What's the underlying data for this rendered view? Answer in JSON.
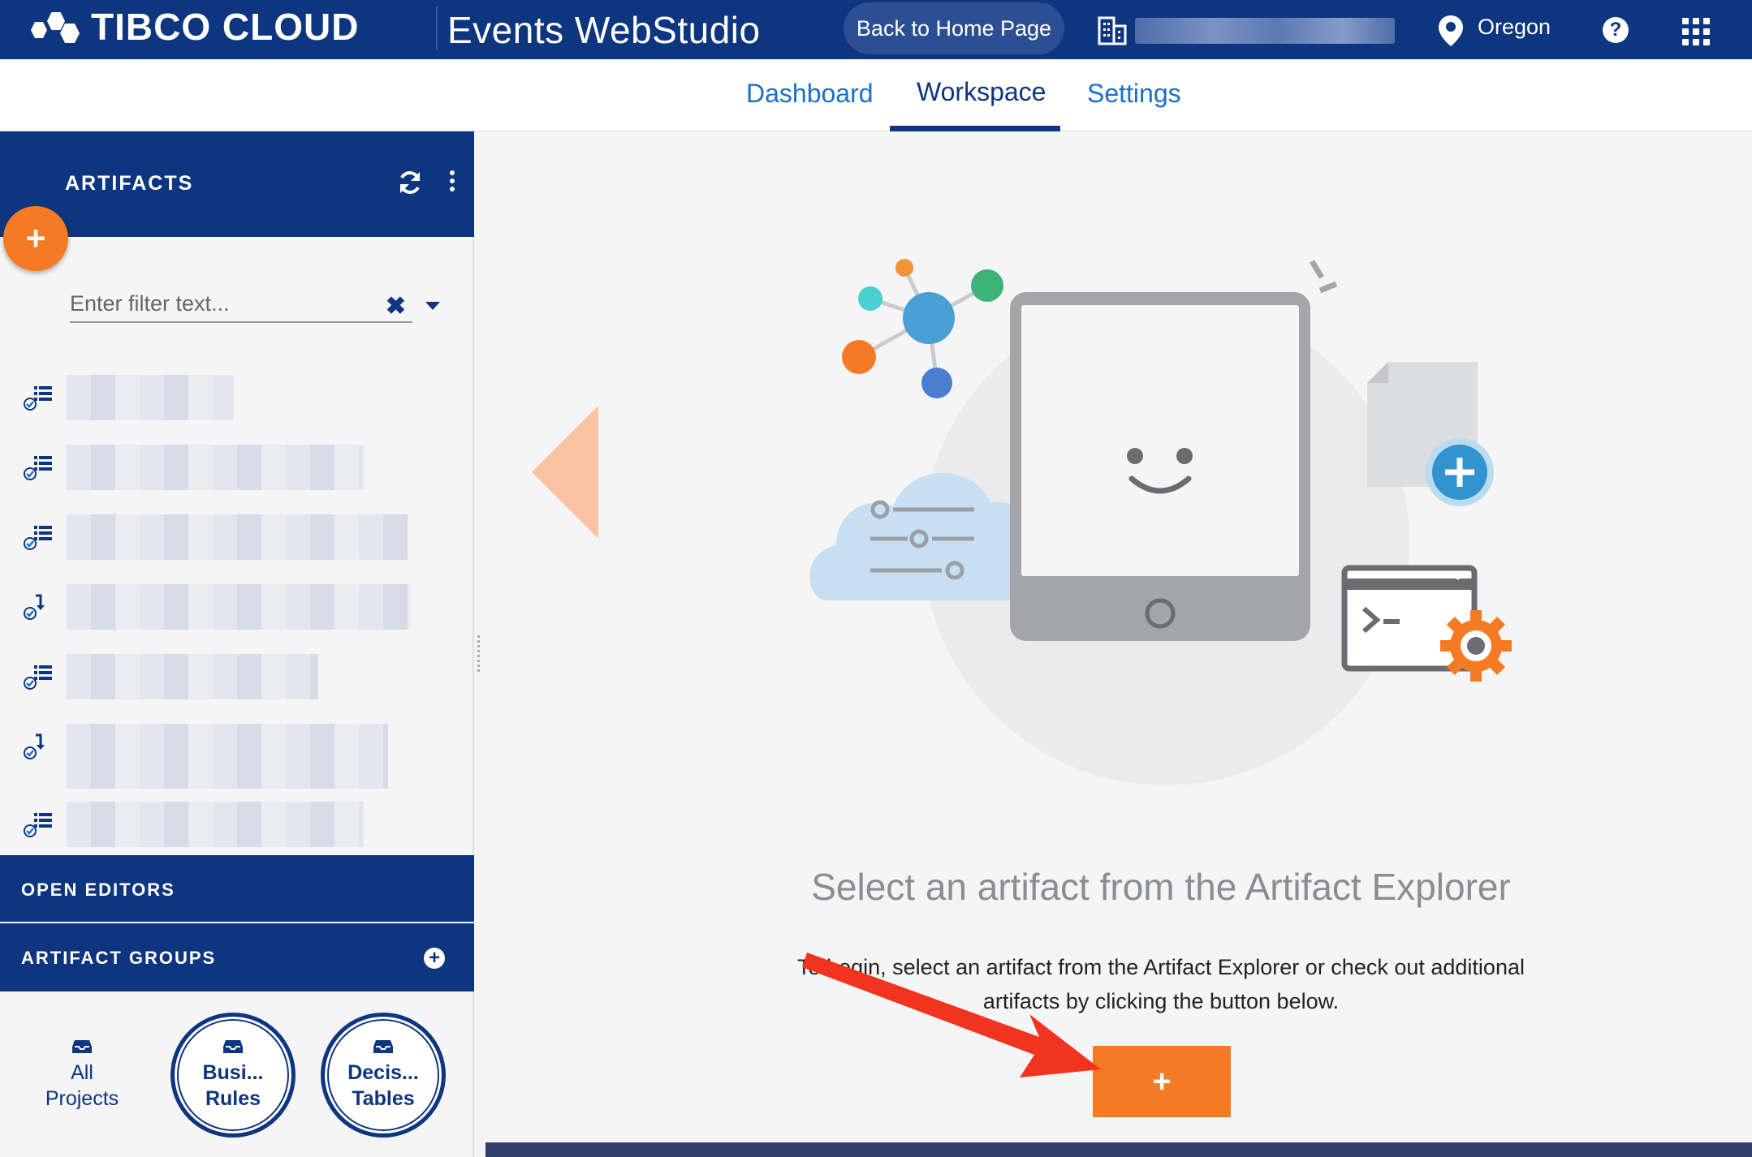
{
  "header": {
    "brand": "TIBCO CLOUD",
    "brand_tm": "™",
    "app_title": "Events WebStudio",
    "home_button": "Back to Home Page",
    "region": "Oregon",
    "help": "?"
  },
  "tabs": [
    {
      "label": "Dashboard"
    },
    {
      "label": "Workspace"
    },
    {
      "label": "Settings"
    }
  ],
  "artifacts_panel": {
    "title": "ARTIFACTS",
    "add_label": "+",
    "filter_placeholder": "Enter filter text...",
    "filter_clear": "✖",
    "items": [
      {
        "icon": "table-check-icon"
      },
      {
        "icon": "table-check-icon"
      },
      {
        "icon": "table-check-icon"
      },
      {
        "icon": "arrow-check-icon"
      },
      {
        "icon": "table-check-icon"
      },
      {
        "icon": "arrow-check-icon"
      },
      {
        "icon": "table-check-icon"
      }
    ]
  },
  "open_editors": {
    "title": "OPEN EDITORS"
  },
  "artifact_groups": {
    "title": "ARTIFACT GROUPS",
    "add_label": "+",
    "groups": [
      {
        "line1": "All",
        "line2": "Projects"
      },
      {
        "line1": "Busi...",
        "line2": "Rules"
      },
      {
        "line1": "Decis...",
        "line2": "Tables"
      }
    ]
  },
  "empty_state": {
    "title": "Select an artifact from the Artifact Explorer",
    "description": "To begin, select an artifact from the Artifact Explorer or check out additional artifacts by clicking the button below.",
    "add_label": "+"
  },
  "colors": {
    "header_bg": "#0e3580",
    "accent_orange": "#f47b23",
    "link_blue": "#1a6fc9",
    "arrow_red": "#f0341f"
  }
}
